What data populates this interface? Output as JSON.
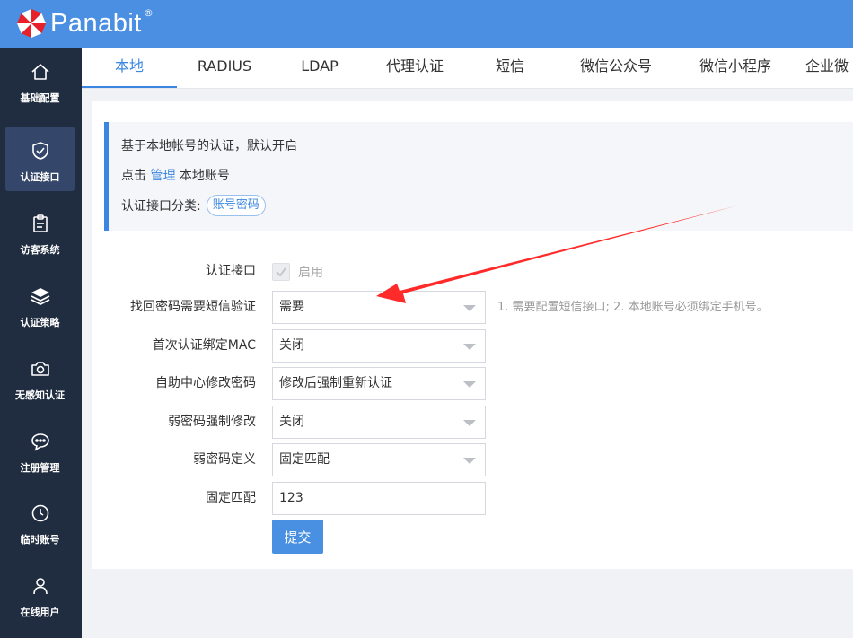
{
  "brand": {
    "name": "Panabit",
    "reg": "®"
  },
  "sidebar": {
    "items": [
      {
        "label": "基础配置",
        "icon": "home-icon"
      },
      {
        "label": "认证接口",
        "icon": "shield-check-icon",
        "active": true
      },
      {
        "label": "访客系统",
        "icon": "clipboard-icon"
      },
      {
        "label": "认证策略",
        "icon": "layers-icon"
      },
      {
        "label": "无感知认证",
        "icon": "camera-icon"
      },
      {
        "label": "注册管理",
        "icon": "chat-icon"
      },
      {
        "label": "临时账号",
        "icon": "clock-icon"
      },
      {
        "label": "在线用户",
        "icon": "user-icon"
      }
    ]
  },
  "tabs": [
    {
      "label": "本地",
      "active": true
    },
    {
      "label": "RADIUS"
    },
    {
      "label": "LDAP"
    },
    {
      "label": "代理认证"
    },
    {
      "label": "短信"
    },
    {
      "label": "微信公众号"
    },
    {
      "label": "微信小程序"
    },
    {
      "label": "企业微"
    }
  ],
  "info": {
    "line1": "基于本地帐号的认证，默认开启",
    "line2_prefix": "点击",
    "line2_link": "管理",
    "line2_suffix": "本地账号",
    "line3_label": "认证接口分类:",
    "line3_tag": "账号密码"
  },
  "form": {
    "enable": {
      "label": "认证接口",
      "checkbox_label": "启用",
      "checked": true,
      "disabled": true
    },
    "sms_verify": {
      "label": "找回密码需要短信验证",
      "value": "需要",
      "hint": "1. 需要配置短信接口; 2. 本地账号必须绑定手机号。"
    },
    "bind_mac": {
      "label": "首次认证绑定MAC",
      "value": "关闭"
    },
    "self_service": {
      "label": "自助中心修改密码",
      "value": "修改后强制重新认证"
    },
    "weak_force": {
      "label": "弱密码强制修改",
      "value": "关闭"
    },
    "weak_define": {
      "label": "弱密码定义",
      "value": "固定匹配"
    },
    "fixed_match": {
      "label": "固定匹配",
      "value": "123"
    },
    "submit_label": "提交"
  },
  "colors": {
    "header": "#4a8fe2",
    "sidebar": "#202c3f",
    "accent": "#3a86e0",
    "arrow": "#ff2a2a"
  }
}
